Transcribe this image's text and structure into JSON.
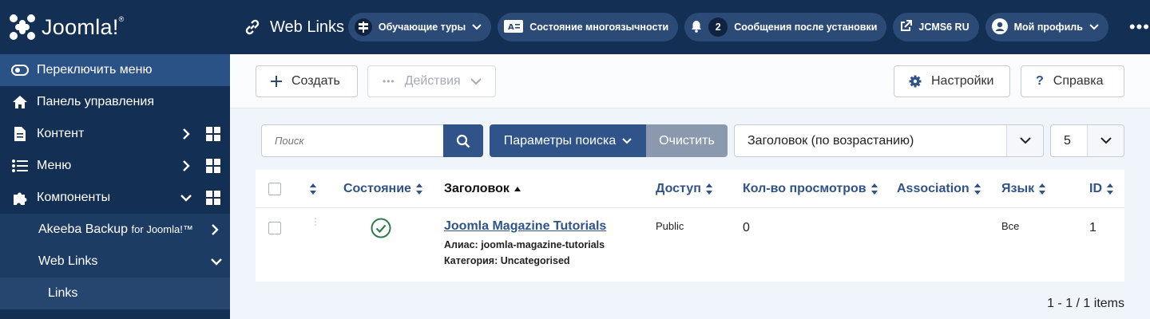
{
  "app": {
    "logo_text": "Joomla!",
    "logo_mark": "®"
  },
  "sidebar": {
    "toggle": "Переключить меню",
    "items": [
      {
        "label": "Панель управления",
        "icon": "home-icon"
      },
      {
        "label": "Контент",
        "icon": "file-icon"
      },
      {
        "label": "Меню",
        "icon": "list-icon"
      },
      {
        "label": "Компоненты",
        "icon": "puzzle-icon"
      }
    ],
    "components": {
      "akeeba": "Akeeba Backup",
      "akeeba_suffix": "for Joomla!™",
      "weblinks": "Web Links",
      "links": "Links"
    }
  },
  "header": {
    "title": "Web Links",
    "pills": [
      {
        "label": "Обучающие туры",
        "icon": "signpost-icon"
      },
      {
        "label": "Состояние многоязычности",
        "icon": "language-icon"
      },
      {
        "count": "2",
        "label": "Сообщения после установки",
        "icon": "bell-icon"
      },
      {
        "label": "JCMS6 RU",
        "icon": "external-link-icon"
      },
      {
        "label": "Мой профиль",
        "icon": "user-icon"
      }
    ],
    "more": "•••"
  },
  "toolbar": {
    "create": "Создать",
    "actions": "Действия",
    "settings": "Настройки",
    "help": "Справка"
  },
  "filters": {
    "search_placeholder": "Поиск",
    "search_options": "Параметры поиска",
    "clear": "Очистить",
    "sort": "Заголовок (по возрастанию)",
    "limit": "5"
  },
  "table": {
    "headers": {
      "status": "Состояние",
      "title": "Заголовок",
      "access": "Доступ",
      "hits": "Кол-во просмотров",
      "association": "Association",
      "language": "Язык",
      "id": "ID"
    },
    "rows": [
      {
        "title": "Joomla Magazine Tutorials",
        "alias": "Алиас: joomla-magazine-tutorials",
        "category": "Категория: Uncategorised",
        "access": "Public",
        "hits": "0",
        "language": "Все",
        "id": "1",
        "status": "published"
      }
    ]
  },
  "pagination": {
    "summary": "1 - 1 / 1 items"
  },
  "colors": {
    "sidebar": "#132f53",
    "accent": "#30538a",
    "published": "#2f7d4f"
  }
}
